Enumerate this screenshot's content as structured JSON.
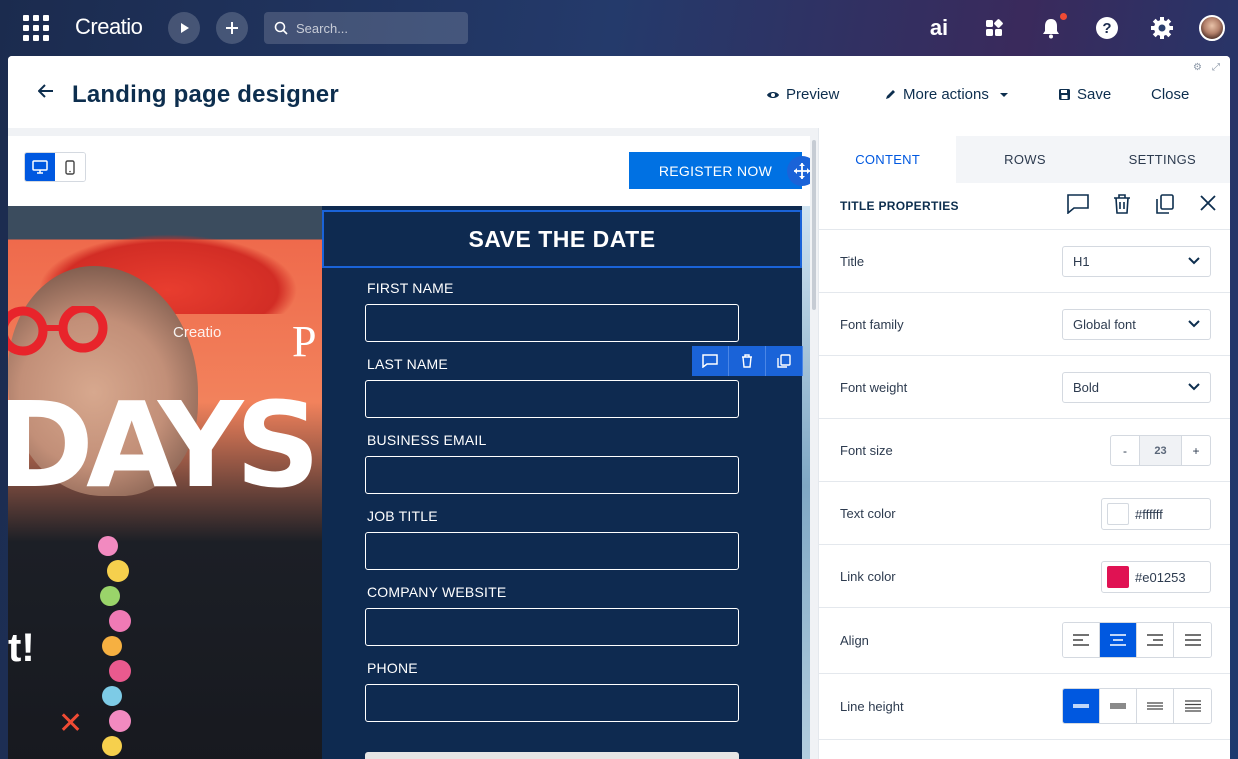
{
  "topbar": {
    "logo": "Creatio",
    "search_placeholder": "Search...",
    "ai_label": "ai"
  },
  "header": {
    "title": "Landing page designer",
    "preview": "Preview",
    "more_actions": "More actions",
    "save": "Save",
    "close": "Close"
  },
  "canvas": {
    "register_button": "REGISTER NOW",
    "form_title": "SAVE THE DATE",
    "hero_text": "DAYS",
    "hero_excl": "t!",
    "brand_p": "P",
    "brand_c": "Creatio",
    "fields": [
      {
        "label": "FIRST NAME"
      },
      {
        "label": "LAST NAME"
      },
      {
        "label": "BUSINESS EMAIL"
      },
      {
        "label": "JOB TITLE"
      },
      {
        "label": "COMPANY WEBSITE"
      },
      {
        "label": "PHONE"
      }
    ]
  },
  "panel": {
    "tabs": [
      "CONTENT",
      "ROWS",
      "SETTINGS"
    ],
    "active_tab": "CONTENT",
    "section_title": "TITLE PROPERTIES",
    "props": {
      "title": {
        "label": "Title",
        "value": "H1"
      },
      "font_family": {
        "label": "Font family",
        "value": "Global font"
      },
      "font_weight": {
        "label": "Font weight",
        "value": "Bold"
      },
      "font_size": {
        "label": "Font size",
        "value": "23",
        "minus": "-",
        "plus": "+"
      },
      "text_color": {
        "label": "Text color",
        "value": "#ffffff"
      },
      "link_color": {
        "label": "Link color",
        "value": "#e01253"
      },
      "align": {
        "label": "Align",
        "selected": "center"
      },
      "line_height": {
        "label": "Line height",
        "selected": "1"
      }
    }
  },
  "colors": {
    "accent": "#0058e0",
    "form_bg": "#0e2a50",
    "text_color_swatch": "#ffffff",
    "link_color_swatch": "#e01253"
  }
}
